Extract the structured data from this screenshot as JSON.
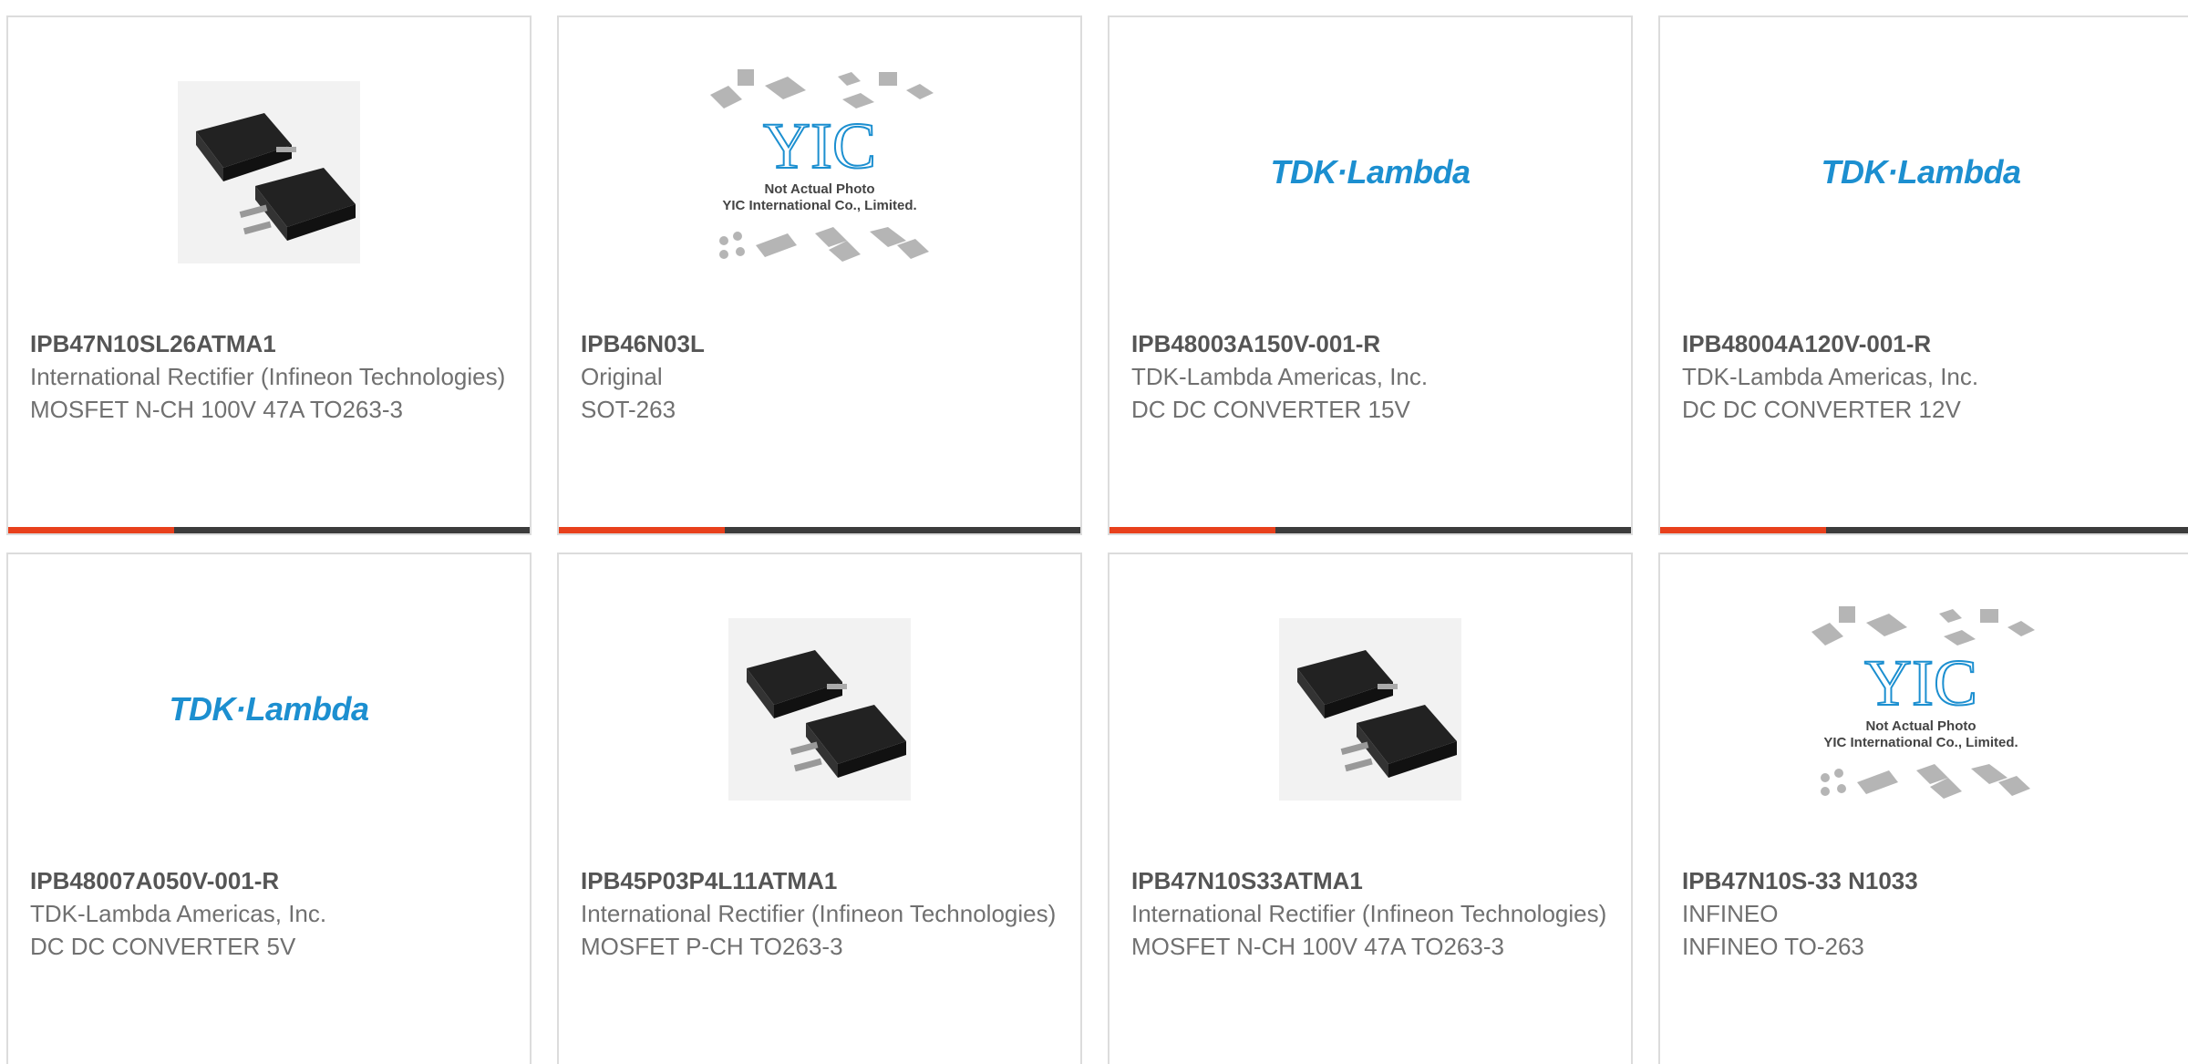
{
  "colors": {
    "accent": "#e8401c",
    "bar": "#3c3c3c",
    "brand_tdk": "#1c8fd0",
    "text": "#707070"
  },
  "placeholder": {
    "line1": "Not Actual Photo",
    "line2": "YIC International Co., Limited.",
    "logo": "YIC"
  },
  "products": [
    {
      "part": "IPB47N10SL26ATMA1",
      "lines": [
        "International Rectifier (Infineon Technologies)",
        "MOSFET N-CH 100V 47A TO263-3"
      ],
      "image": "to263-package"
    },
    {
      "part": "IPB46N03L",
      "lines": [
        "Original",
        "SOT-263"
      ],
      "image": "not-actual-photo"
    },
    {
      "part": "IPB48003A150V-001-R",
      "lines": [
        "TDK-Lambda Americas, Inc.",
        "DC DC CONVERTER 15V"
      ],
      "image": "tdk-lambda-logo",
      "logo_text": "TDK·Lambda"
    },
    {
      "part": "IPB48004A120V-001-R",
      "lines": [
        "TDK-Lambda Americas, Inc.",
        "DC DC CONVERTER 12V"
      ],
      "image": "tdk-lambda-logo",
      "logo_text": "TDK·Lambda"
    },
    {
      "part": "IPB48007A050V-001-R",
      "lines": [
        "TDK-Lambda Americas, Inc.",
        "DC DC CONVERTER 5V"
      ],
      "image": "tdk-lambda-logo",
      "logo_text": "TDK·Lambda"
    },
    {
      "part": "IPB45P03P4L11ATMA1",
      "lines": [
        "International Rectifier (Infineon Technologies)",
        "MOSFET P-CH TO263-3"
      ],
      "image": "to263-package"
    },
    {
      "part": "IPB47N10S33ATMA1",
      "lines": [
        "International Rectifier (Infineon Technologies)",
        "MOSFET N-CH 100V 47A TO263-3"
      ],
      "image": "to263-package"
    },
    {
      "part": "IPB47N10S-33 N1033",
      "lines": [
        "INFINEO",
        "INFINEO TO-263"
      ],
      "image": "not-actual-photo"
    }
  ]
}
